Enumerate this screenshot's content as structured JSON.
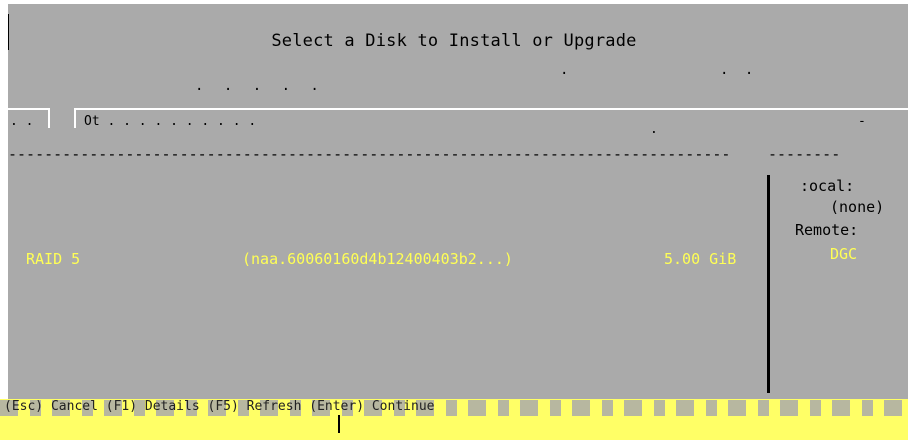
{
  "dialog": {
    "title": "Select a Disk to Install or Upgrade",
    "hint_left": ". .   . . .",
    "hint_mid": ".",
    "hint_right": ". ."
  },
  "table": {
    "header_col1": ". .",
    "header_col2": "Ot . . . . . . . . . .",
    "header_right_dot": ".",
    "header_right_dash": "-",
    "separator_left": "----------------------------------------------------------------------------------------------",
    "separator_right": "--------",
    "rows": [
      {
        "name": "RAID 5",
        "identifier": "(naa.60060160d4b12400403b2...)",
        "capacity": "5.00 GiB"
      }
    ]
  },
  "details": {
    "local_label": ":ocal:",
    "local_value": "(none)",
    "remote_label": "Remote:",
    "remote_value": "DGC"
  },
  "footer": {
    "text": "(Esc) Cancel   (F1) Details   (F5) Refresh   (Enter) Continue"
  },
  "colors": {
    "panel_bg": "#aaaaaa",
    "highlight_text": "#ffff55",
    "footer_bg": "#ffff66",
    "outer_bg": "#ffffff"
  }
}
